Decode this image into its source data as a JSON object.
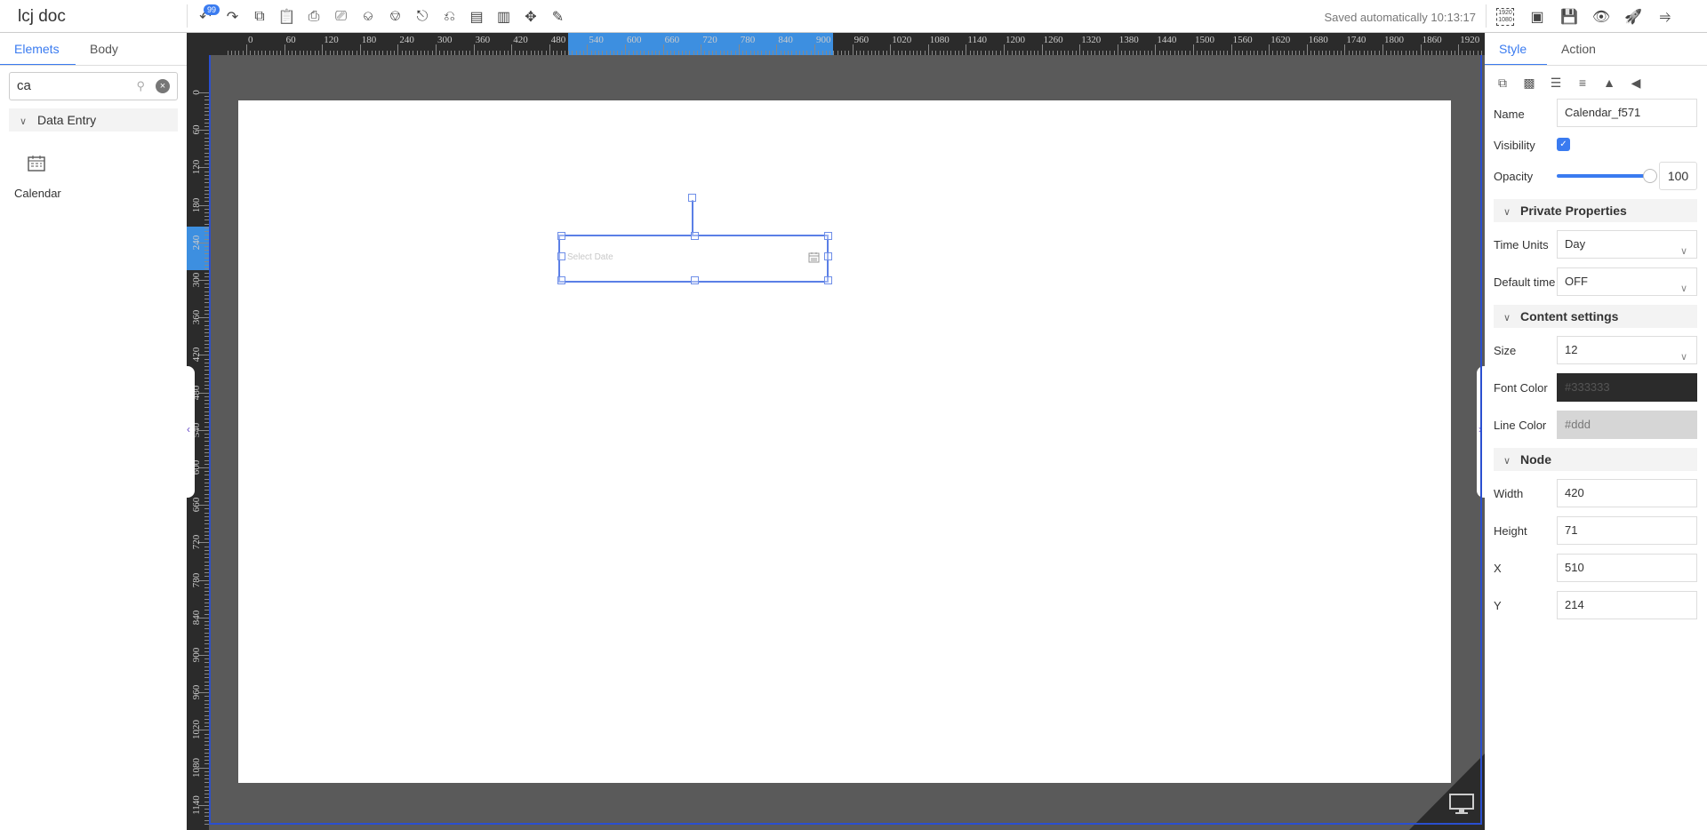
{
  "app": {
    "title": "lcj doc",
    "undo_count": "99",
    "saved_status": "Saved automatically 10:13:17"
  },
  "toolbar": {
    "left_icons": [
      "undo-icon",
      "redo-icon",
      "copy-icon",
      "paste-icon",
      "align-left-icon",
      "align-right-icon",
      "align-top-icon",
      "align-bottom-icon",
      "align-center-horizontal-icon",
      "align-center-vertical-icon",
      "distribute-vertical-icon",
      "distribute-horizontal-icon",
      "move-icon",
      "brush-icon"
    ],
    "right_icons": [
      "resolution-1920-1080-icon",
      "fit-screen-icon",
      "save-icon",
      "preview-eye-icon",
      "publish-rocket-icon",
      "share-icon"
    ],
    "resolution_label": "1920 1080"
  },
  "left_panel": {
    "tabs": [
      {
        "label": "Elemets",
        "active": true
      },
      {
        "label": "Body",
        "active": false
      }
    ],
    "search": {
      "value": "ca"
    },
    "group": "Data Entry",
    "items": [
      {
        "label": "Calendar",
        "icon": "calendar-icon"
      }
    ]
  },
  "canvas": {
    "h_ruler": [
      "0",
      "60",
      "120",
      "180",
      "240",
      "300",
      "360",
      "420",
      "480",
      "540",
      "600",
      "660",
      "720",
      "780",
      "840",
      "900",
      "960",
      "1020",
      "1080",
      "1140",
      "1200",
      "1260",
      "1320",
      "1380",
      "1440",
      "1500",
      "1560",
      "1620",
      "1680",
      "1740",
      "1800",
      "1860",
      "1920"
    ],
    "v_ruler": [
      "0",
      "60",
      "120",
      "180",
      "240",
      "300",
      "360",
      "420",
      "480",
      "540",
      "600",
      "660",
      "720",
      "780",
      "840",
      "900",
      "960",
      "1020",
      "1080",
      "1140"
    ],
    "h_highlight": [
      510,
      930
    ],
    "v_highlight": [
      214,
      285
    ],
    "element": {
      "placeholder": "Select Date"
    },
    "colors": {
      "accent": "#3a7bf0",
      "selection": "#5b7fe6",
      "ruler": "#2b2b2b",
      "stage": "#5a5a5a"
    }
  },
  "right_panel": {
    "tabs": [
      {
        "label": "Style",
        "active": true
      },
      {
        "label": "Action",
        "active": false
      }
    ],
    "layer_icons": [
      "bring-front-icon",
      "send-back-icon",
      "layer-up-icon",
      "layer-down-icon",
      "flip-horizontal-icon",
      "flip-vertical-icon"
    ],
    "name": {
      "label": "Name",
      "value": "Calendar_f571"
    },
    "visibility": {
      "label": "Visibility",
      "checked": true
    },
    "opacity": {
      "label": "Opacity",
      "value": "100"
    },
    "private": {
      "title": "Private Properties",
      "time_units": {
        "label": "Time Units",
        "value": "Day"
      },
      "default_time": {
        "label": "Default time",
        "value": "OFF"
      }
    },
    "content": {
      "title": "Content settings",
      "size": {
        "label": "Size",
        "value": "12"
      },
      "font_color": {
        "label": "Font Color",
        "value": "#333333"
      },
      "line_color": {
        "label": "Line Color",
        "value": "#ddd"
      }
    },
    "node": {
      "title": "Node",
      "width": {
        "label": "Width",
        "value": "420"
      },
      "height": {
        "label": "Height",
        "value": "71"
      },
      "x": {
        "label": "X",
        "value": "510"
      },
      "y": {
        "label": "Y",
        "value": "214"
      }
    }
  }
}
